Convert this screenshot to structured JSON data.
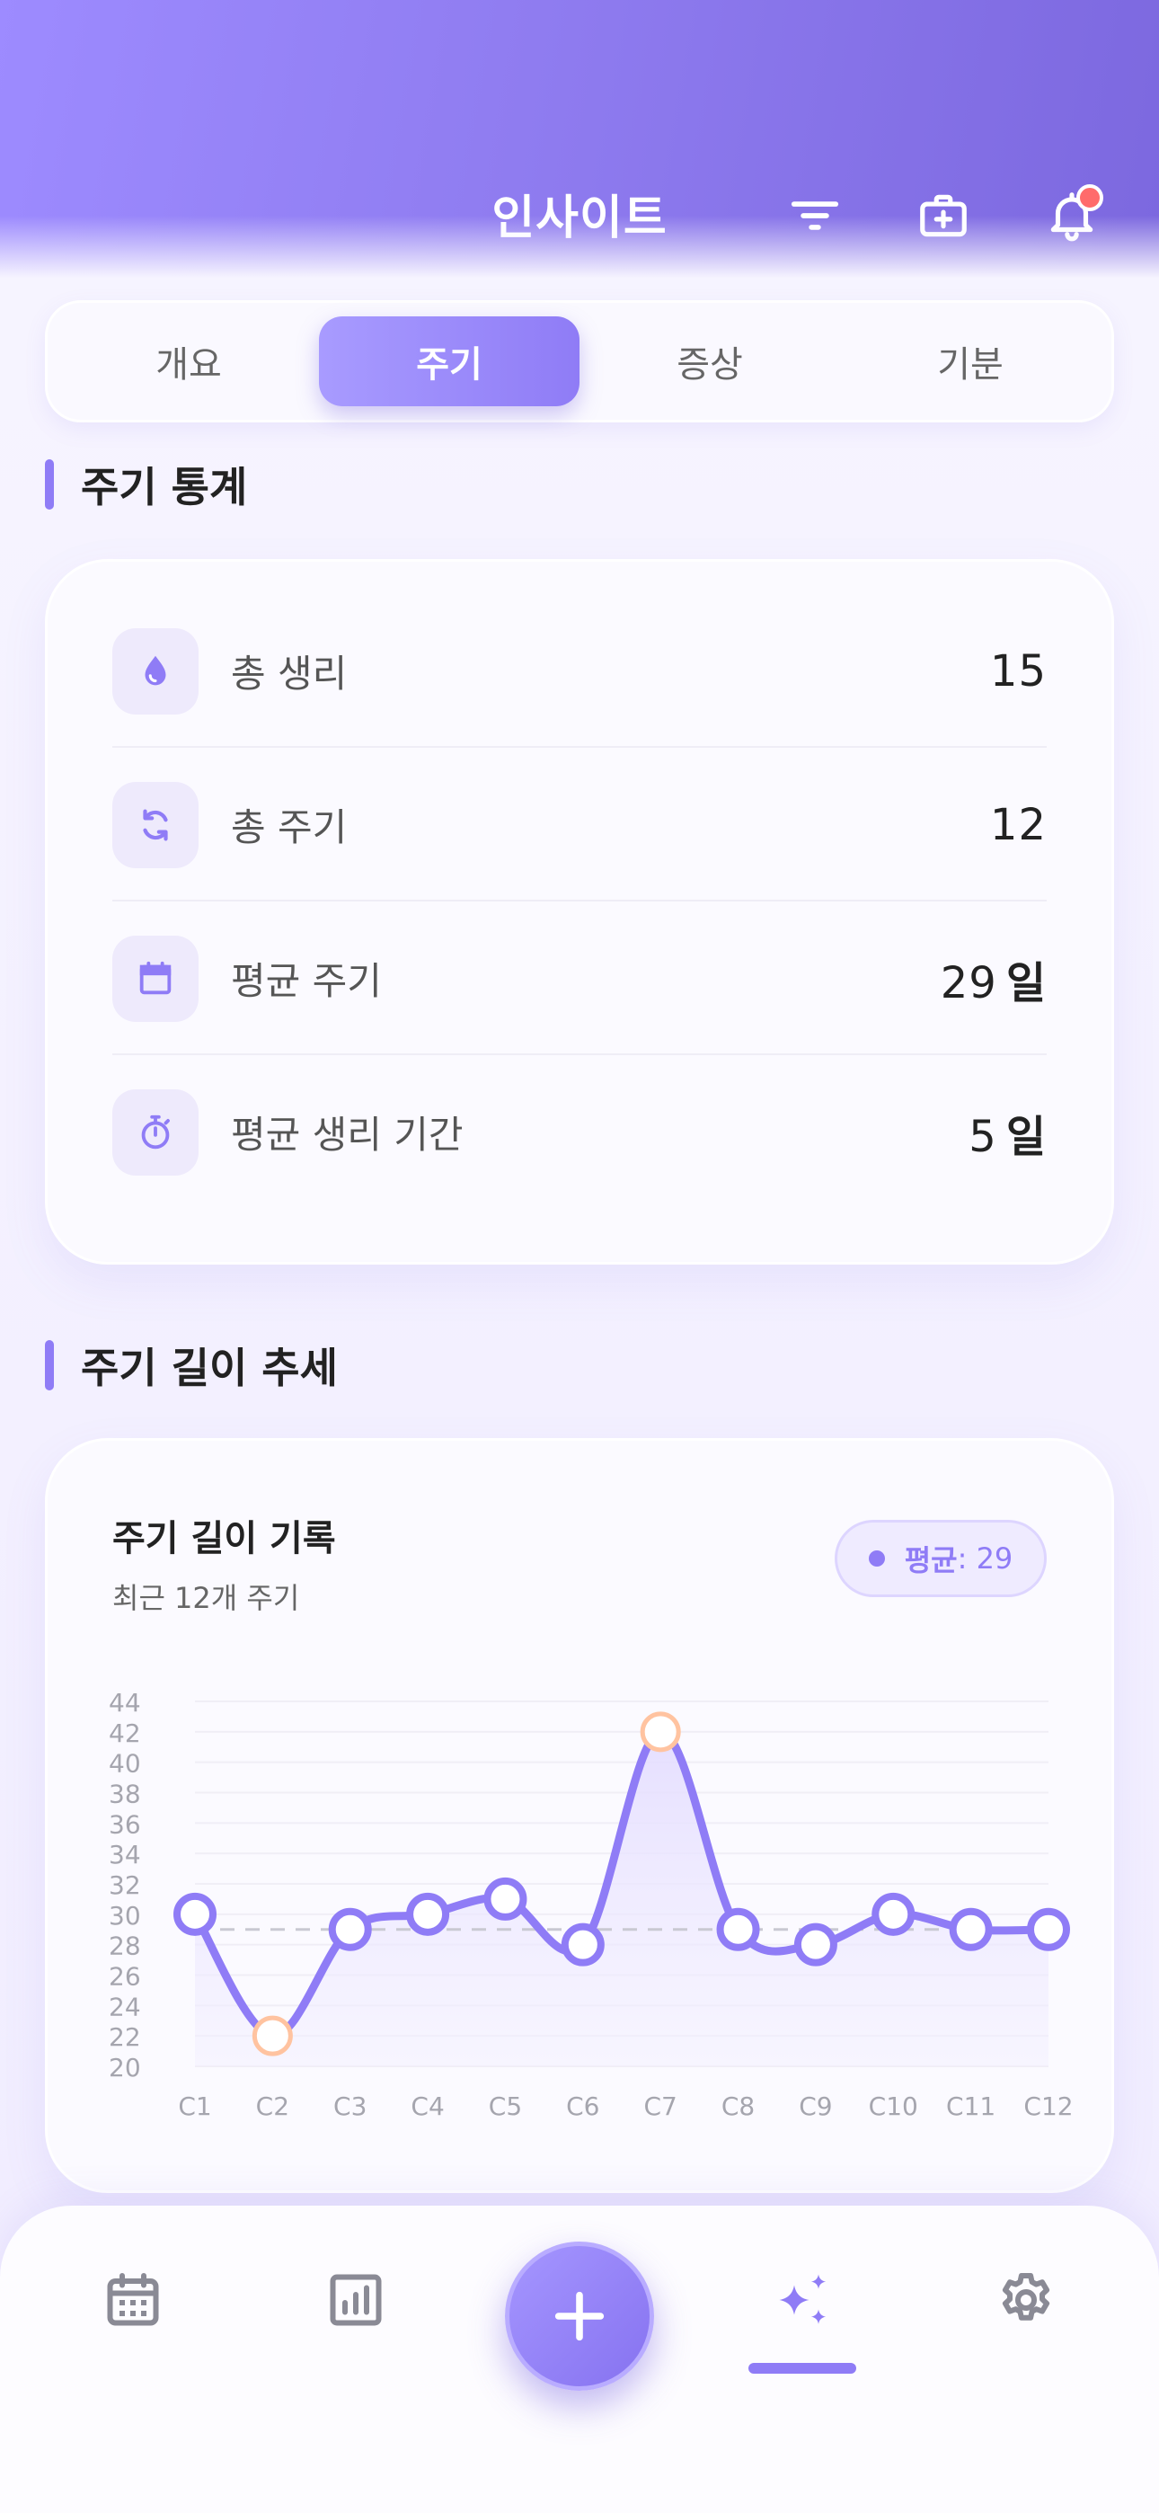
{
  "header": {
    "title": "인사이트",
    "icons": [
      "filter-icon",
      "medical-kit-icon",
      "bell-icon"
    ],
    "notification_dot_color": "#ff6b6b"
  },
  "tabs": [
    {
      "label": "개요",
      "active": false
    },
    {
      "label": "주기",
      "active": true
    },
    {
      "label": "증상",
      "active": false
    },
    {
      "label": "기분",
      "active": false
    }
  ],
  "stats_section": {
    "title": "주기 통계",
    "rows": [
      {
        "icon": "drop-icon",
        "label": "총 생리",
        "value": "15",
        "unit": ""
      },
      {
        "icon": "cycle-icon",
        "label": "총 주기",
        "value": "12",
        "unit": ""
      },
      {
        "icon": "calendar-icon",
        "label": "평균 주기",
        "value": "29",
        "unit": "일"
      },
      {
        "icon": "timer-icon",
        "label": "평균 생리 기간",
        "value": "5",
        "unit": "일"
      }
    ]
  },
  "trend_section": {
    "title": "주기 길이 추세",
    "chart_title": "주기 길이 기록",
    "chart_subtitle": "최근 12개 주기",
    "avg_label": "평균",
    "avg_value": ": 29"
  },
  "chart_data": {
    "type": "line",
    "categories": [
      "C1",
      "C2",
      "C3",
      "C4",
      "C5",
      "C6",
      "C7",
      "C8",
      "C9",
      "C10",
      "C11",
      "C12"
    ],
    "series": [
      {
        "values": [
          30,
          22,
          29,
          30,
          31,
          28,
          42,
          29,
          28,
          30,
          29,
          29
        ]
      }
    ],
    "average": 29,
    "outliers": [
      1,
      6
    ],
    "ylim": [
      20,
      44
    ],
    "yticks": [
      20,
      22,
      24,
      26,
      28,
      30,
      32,
      34,
      36,
      38,
      40,
      42,
      44
    ],
    "grid": true,
    "colors": {
      "line": "#8f7cf6",
      "outlier": "#ffc3a0",
      "average_line": "#c9c9d2",
      "area": "#ebe6ff"
    }
  },
  "bottom_nav": {
    "items": [
      "calendar-icon",
      "stats-icon",
      "add-icon",
      "sparkles-icon",
      "settings-icon"
    ],
    "active": "sparkles-icon"
  },
  "colors": {
    "accent": "#8f7cf6",
    "header_start": "#9d8bff",
    "header_end": "#7c68df"
  }
}
